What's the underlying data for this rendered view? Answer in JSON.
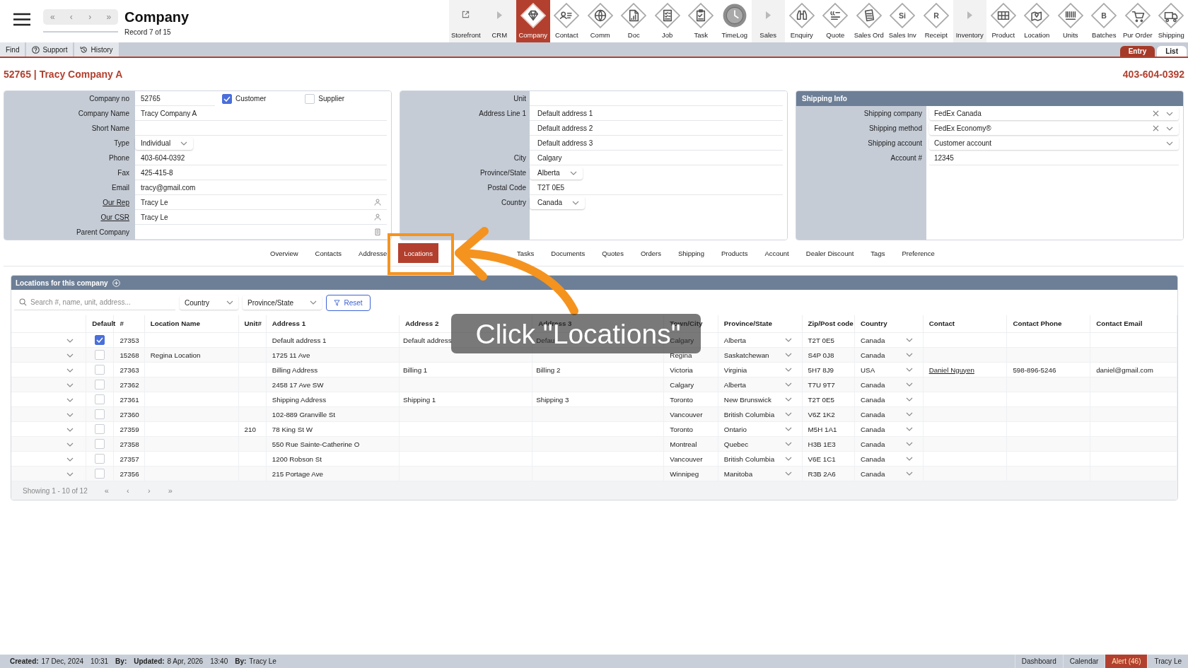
{
  "header": {
    "record_nav": [
      "«",
      "‹",
      "›",
      "»"
    ],
    "title": "Company",
    "subtitle": "Record 7 of 15"
  },
  "modules": [
    {
      "label": "Storefront",
      "kind": "link",
      "selected": false
    },
    {
      "label": "CRM",
      "kind": "section",
      "selected": false
    },
    {
      "label": "Company",
      "kind": "module",
      "selected": true
    },
    {
      "label": "Contact",
      "kind": "module",
      "selected": false
    },
    {
      "label": "Comm",
      "kind": "module",
      "selected": false
    },
    {
      "label": "Doc",
      "kind": "module",
      "selected": false
    },
    {
      "label": "Job",
      "kind": "module",
      "selected": false
    },
    {
      "label": "Task",
      "kind": "module",
      "selected": false
    },
    {
      "label": "TimeLog",
      "kind": "module",
      "selected": false
    },
    {
      "label": "Sales",
      "kind": "section",
      "selected": false
    },
    {
      "label": "Enquiry",
      "kind": "module",
      "selected": false
    },
    {
      "label": "Quote",
      "kind": "module",
      "selected": false
    },
    {
      "label": "Sales Ord",
      "kind": "module",
      "selected": false
    },
    {
      "label": "Sales Inv",
      "kind": "module",
      "selected": false,
      "icon_text": "Si"
    },
    {
      "label": "Receipt",
      "kind": "module",
      "selected": false,
      "icon_text": "R"
    },
    {
      "label": "Inventory",
      "kind": "section",
      "selected": false
    },
    {
      "label": "Product",
      "kind": "module",
      "selected": false
    },
    {
      "label": "Location",
      "kind": "module",
      "selected": false
    },
    {
      "label": "Units",
      "kind": "module",
      "selected": false
    },
    {
      "label": "Batches",
      "kind": "module",
      "selected": false,
      "icon_text": "B"
    },
    {
      "label": "Pur Order",
      "kind": "module",
      "selected": false
    },
    {
      "label": "Shipping",
      "kind": "module",
      "selected": false
    }
  ],
  "toolbar": [
    {
      "label": "Find"
    },
    {
      "label": "Support"
    },
    {
      "label": "History"
    }
  ],
  "view_tabs": [
    {
      "label": "Entry",
      "selected": true
    },
    {
      "label": "List",
      "selected": false
    }
  ],
  "record": {
    "title": "52765 | Tracy Company A",
    "phone": "403-604-0392"
  },
  "company_panel": {
    "rows": [
      {
        "label": "Company no",
        "kind": "text",
        "link": false,
        "value": "52765",
        "checkboxes": [
          {
            "label": "Customer",
            "checked": true
          },
          {
            "label": "Supplier",
            "checked": false
          }
        ]
      },
      {
        "label": "Company Name",
        "kind": "text",
        "link": false,
        "value": "Tracy Company A"
      },
      {
        "label": "Short Name",
        "kind": "text",
        "link": false
      },
      {
        "label": "Type",
        "kind": "select",
        "link": false,
        "value": "Individual"
      },
      {
        "label": "Phone",
        "kind": "text",
        "link": false,
        "value": "403-604-0392"
      },
      {
        "label": "Fax",
        "kind": "text",
        "link": false,
        "value": "425-415-8"
      },
      {
        "label": "Email",
        "kind": "text",
        "link": false,
        "value": "tracy@gmail.com"
      },
      {
        "label": "Our Rep",
        "kind": "person",
        "link": true,
        "value": "Tracy Le"
      },
      {
        "label": "Our CSR",
        "kind": "person",
        "link": true,
        "value": "Tracy Le"
      },
      {
        "label": "Parent Company",
        "kind": "picker",
        "link": false
      }
    ]
  },
  "address_panel": {
    "rows": [
      {
        "label": "Unit",
        "kind": "text"
      },
      {
        "label": "Address Line 1",
        "kind": "text",
        "value": "Default address 1"
      },
      {
        "kind": "text",
        "value": "Default address 2"
      },
      {
        "kind": "text",
        "value": "Default address 3"
      },
      {
        "label": "City",
        "kind": "text",
        "value": "Calgary"
      },
      {
        "label": "Province/State",
        "kind": "select",
        "value": "Alberta"
      },
      {
        "label": "Postal Code",
        "kind": "text",
        "value": "T2T 0E5"
      },
      {
        "label": "Country",
        "kind": "select",
        "value": "Canada"
      }
    ]
  },
  "shipping_panel": {
    "title": "Shipping Info",
    "rows": [
      {
        "label": "Shipping company",
        "kind": "select",
        "clearable": true,
        "value": "FedEx Canada"
      },
      {
        "label": "Shipping method",
        "kind": "select",
        "clearable": true,
        "value": "FedEx Economy®"
      },
      {
        "label": "Shipping account",
        "kind": "select",
        "clearable": false,
        "value": "Customer account"
      },
      {
        "label": "Account #",
        "kind": "text",
        "clearable": false,
        "value": "12345"
      }
    ]
  },
  "section_tabs": [
    {
      "label": "Overview",
      "selected": false
    },
    {
      "label": "Contacts",
      "selected": false
    },
    {
      "label": "Addresse",
      "selected": false
    },
    {
      "label": "Locations",
      "selected": true
    },
    {
      "label": "Tasks",
      "selected": false
    },
    {
      "label": "Documents",
      "selected": false
    },
    {
      "label": "Quotes",
      "selected": false
    },
    {
      "label": "Orders",
      "selected": false
    },
    {
      "label": "Shipping",
      "selected": false
    },
    {
      "label": "Products",
      "selected": false
    },
    {
      "label": "Account",
      "selected": false
    },
    {
      "label": "Dealer Discount",
      "selected": false
    },
    {
      "label": "Tags",
      "selected": false
    },
    {
      "label": "Preference",
      "selected": false
    }
  ],
  "locations": {
    "title": "Locations for this company",
    "search": {
      "placeholder": "Search #, name, unit, address..."
    },
    "filters": [
      {
        "label": "Country"
      },
      {
        "label": "Province/State"
      }
    ],
    "reset": "Reset",
    "columns": [
      "Default",
      "#",
      "Location Name",
      "Unit#",
      "Address 1",
      "Address 2",
      "Address 3",
      "Town/City",
      "Province/State",
      "Zip/Post code",
      "Country",
      "Contact",
      "Contact Phone",
      "Contact Email"
    ],
    "rows": [
      {
        "default": true,
        "id": "27353",
        "address_1": "Default address 1",
        "address_2": "Default address",
        "address_3": "Defaul",
        "city": "Calgary",
        "province": "Alberta",
        "zip": "T2T 0E5",
        "country": "Canada"
      },
      {
        "default": false,
        "id": "15268",
        "name": "Regina Location",
        "address_1": "1725 11 Ave",
        "city": "Regina",
        "province": "Saskatchewan",
        "zip": "S4P 0J8",
        "country": "Canada"
      },
      {
        "default": false,
        "id": "27363",
        "address_1": "Billing Address",
        "address_2": "Billing 1",
        "address_3": "Billing 2",
        "city": "Victoria",
        "province": "Virginia",
        "zip": "5H7 8J9",
        "country": "USA",
        "contact": "Daniel Nguyen",
        "contact_phone": "598-896-5246",
        "contact_email": "daniel@gmail.com"
      },
      {
        "default": false,
        "id": "27362",
        "address_1": "2458 17 Ave SW",
        "city": "Calgary",
        "province": "Alberta",
        "zip": "T7U 9T7",
        "country": "Canada"
      },
      {
        "default": false,
        "id": "27361",
        "address_1": "Shipping Address",
        "address_2": "Shipping 1",
        "address_3": "Shipping 3",
        "city": "Toronto",
        "province": "New Brunswick",
        "zip": "T2T 0E5",
        "country": "Canada"
      },
      {
        "default": false,
        "id": "27360",
        "address_1": "102-889 Granville St",
        "city": "Vancouver",
        "province": "British Columbia",
        "zip": "V6Z 1K2",
        "country": "Canada"
      },
      {
        "default": false,
        "id": "27359",
        "unit": "210",
        "address_1": "78 King St W",
        "city": "Toronto",
        "province": "Ontario",
        "zip": "M5H 1A1",
        "country": "Canada"
      },
      {
        "default": false,
        "id": "27358",
        "address_1": "550 Rue Sainte-Catherine O",
        "city": "Montreal",
        "province": "Quebec",
        "zip": "H3B 1E3",
        "country": "Canada"
      },
      {
        "default": false,
        "id": "27357",
        "address_1": "1200 Robson St",
        "city": "Vancouver",
        "province": "British Columbia",
        "zip": "V6E 1C1",
        "country": "Canada"
      },
      {
        "default": false,
        "id": "27356",
        "address_1": "215 Portage Ave",
        "city": "Winnipeg",
        "province": "Manitoba",
        "zip": "R3B 2A6",
        "country": "Canada"
      }
    ],
    "footer": "Showing 1 - 10 of 12",
    "pager": [
      "«",
      "‹",
      "›",
      "»"
    ]
  },
  "status_bar": {
    "left": [
      {
        "label": "Created:",
        "value": "17 Dec, 2024"
      },
      {
        "value": "10:31"
      },
      {
        "label": "By:"
      },
      {
        "label": "Updated:",
        "value": "8 Apr, 2026"
      },
      {
        "value": "13:40"
      },
      {
        "label": "By:",
        "value": "Tracy Le"
      }
    ],
    "right": [
      {
        "label": "Dashboard",
        "kind": "link"
      },
      {
        "label": "Calendar",
        "kind": "link"
      },
      {
        "label": "Alert (46)",
        "kind": "alert"
      },
      {
        "label": "Tracy Le",
        "kind": "link"
      }
    ]
  },
  "annotation": {
    "callout": "Click \"Locations\""
  }
}
